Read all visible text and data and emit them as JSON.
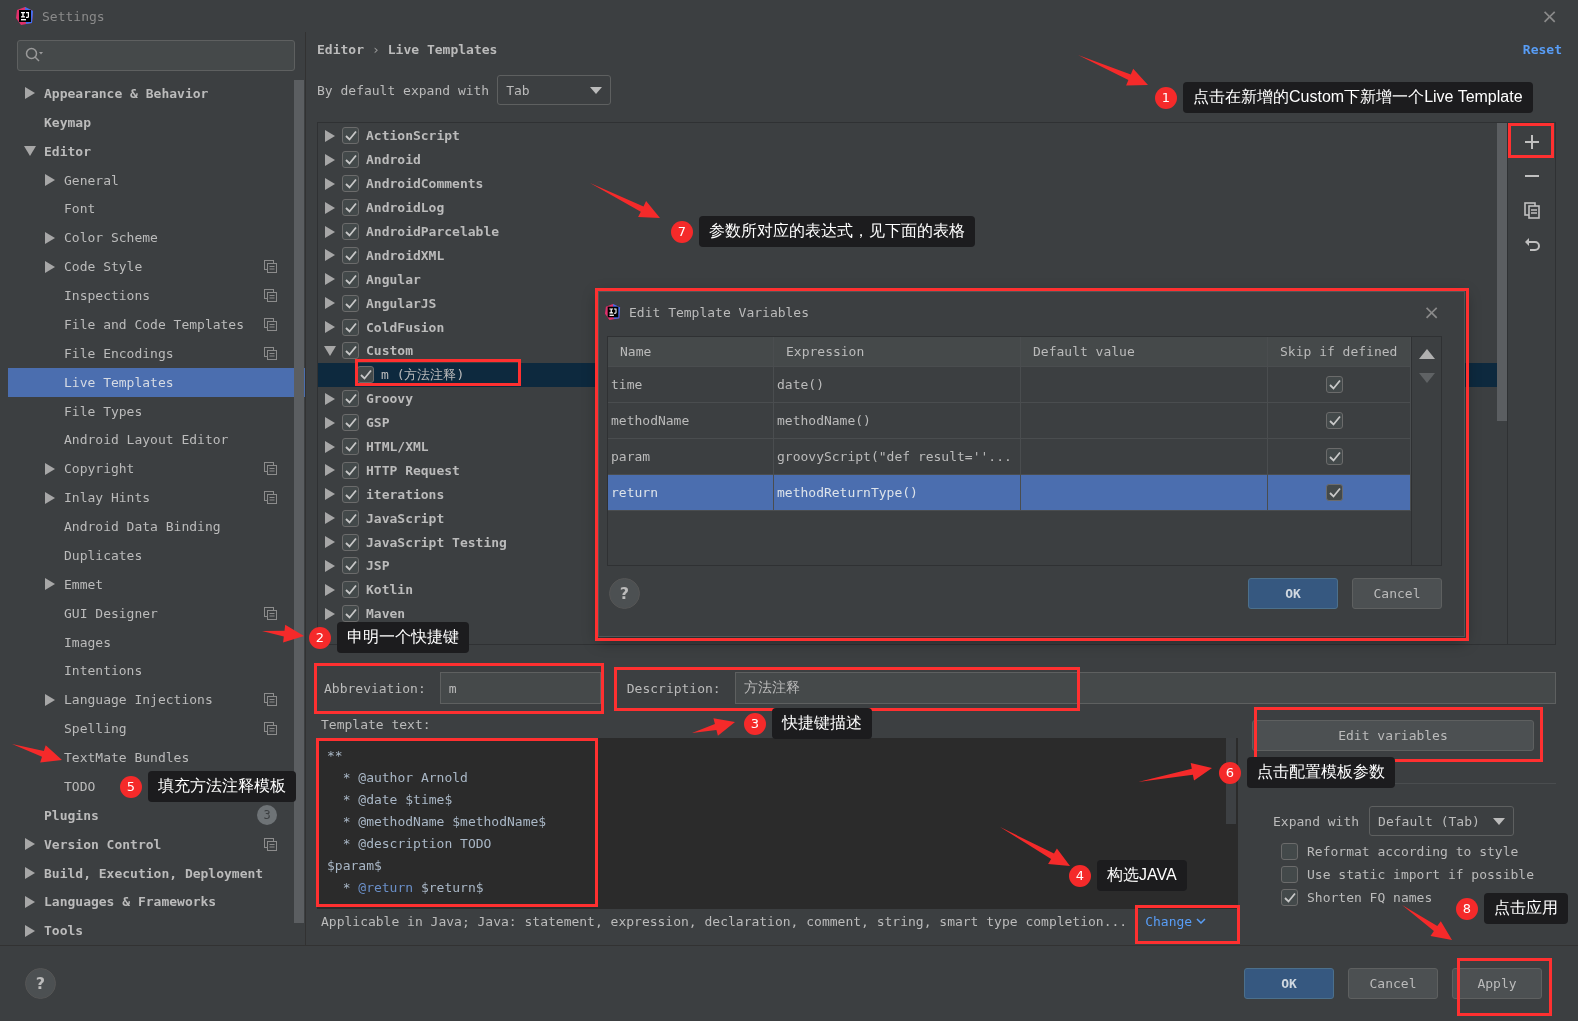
{
  "window": {
    "title": "Settings",
    "close": "×"
  },
  "sidebar": {
    "items": [
      {
        "label": "Appearance & Behavior",
        "kind": "folder",
        "expanded": false,
        "selected": false
      },
      {
        "label": "Keymap",
        "kind": "leaf",
        "selected": false
      },
      {
        "label": "Editor",
        "kind": "folder",
        "expanded": true,
        "selected": false,
        "children": [
          {
            "label": "General",
            "kind": "folder",
            "expanded": false,
            "selected": false
          },
          {
            "label": "Font",
            "kind": "leaf",
            "selected": false
          },
          {
            "label": "Color Scheme",
            "kind": "folder",
            "expanded": false,
            "selected": false
          },
          {
            "label": "Code Style",
            "kind": "folder",
            "expanded": false,
            "selected": false,
            "shared": true
          },
          {
            "label": "Inspections",
            "kind": "leaf",
            "selected": false,
            "shared": true
          },
          {
            "label": "File and Code Templates",
            "kind": "leaf",
            "selected": false,
            "shared": true
          },
          {
            "label": "File Encodings",
            "kind": "leaf",
            "selected": false,
            "shared": true
          },
          {
            "label": "Live Templates",
            "kind": "leaf",
            "selected": true
          },
          {
            "label": "File Types",
            "kind": "leaf",
            "selected": false
          },
          {
            "label": "Android Layout Editor",
            "kind": "leaf",
            "selected": false
          },
          {
            "label": "Copyright",
            "kind": "folder",
            "expanded": false,
            "selected": false,
            "shared": true
          },
          {
            "label": "Inlay Hints",
            "kind": "folder",
            "expanded": false,
            "selected": false,
            "shared": true
          },
          {
            "label": "Android Data Binding",
            "kind": "leaf",
            "selected": false
          },
          {
            "label": "Duplicates",
            "kind": "leaf",
            "selected": false
          },
          {
            "label": "Emmet",
            "kind": "folder",
            "expanded": false,
            "selected": false
          },
          {
            "label": "GUI Designer",
            "kind": "leaf",
            "selected": false,
            "shared": true
          },
          {
            "label": "Images",
            "kind": "leaf",
            "selected": false
          },
          {
            "label": "Intentions",
            "kind": "leaf",
            "selected": false
          },
          {
            "label": "Language Injections",
            "kind": "folder",
            "expanded": false,
            "selected": false,
            "shared": true
          },
          {
            "label": "Spelling",
            "kind": "leaf",
            "selected": false,
            "shared": true
          },
          {
            "label": "TextMate Bundles",
            "kind": "leaf",
            "selected": false
          },
          {
            "label": "TODO",
            "kind": "leaf",
            "selected": false
          }
        ]
      },
      {
        "label": "Plugins",
        "kind": "leaf",
        "selected": false,
        "badge": "3"
      },
      {
        "label": "Version Control",
        "kind": "folder",
        "expanded": false,
        "selected": false,
        "shared": true
      },
      {
        "label": "Build, Execution, Deployment",
        "kind": "folder",
        "expanded": false,
        "selected": false
      },
      {
        "label": "Languages & Frameworks",
        "kind": "folder",
        "expanded": false,
        "selected": false
      },
      {
        "label": "Tools",
        "kind": "folder",
        "expanded": false,
        "selected": false
      }
    ]
  },
  "breadcrumb": {
    "items": [
      "Editor",
      "Live Templates"
    ],
    "separator": "›"
  },
  "reset_link": "Reset",
  "expand_default": {
    "label": "By default expand with",
    "value": "Tab"
  },
  "template_groups": [
    {
      "name": "ActionScript",
      "checked": true,
      "expanded": false,
      "selected": false
    },
    {
      "name": "Android",
      "checked": true,
      "expanded": false,
      "selected": false
    },
    {
      "name": "AndroidComments",
      "checked": true,
      "expanded": false,
      "selected": false
    },
    {
      "name": "AndroidLog",
      "checked": true,
      "expanded": false,
      "selected": false
    },
    {
      "name": "AndroidParcelable",
      "checked": true,
      "expanded": false,
      "selected": false
    },
    {
      "name": "AndroidXML",
      "checked": true,
      "expanded": false,
      "selected": false
    },
    {
      "name": "Angular",
      "checked": true,
      "expanded": false,
      "selected": false
    },
    {
      "name": "AngularJS",
      "checked": true,
      "expanded": false,
      "selected": false
    },
    {
      "name": "ColdFusion",
      "checked": true,
      "expanded": false,
      "selected": false
    },
    {
      "name": "Custom",
      "checked": true,
      "expanded": true,
      "selected": false,
      "children": [
        {
          "name": "m (方法注释)",
          "checked": true,
          "selected": true
        }
      ]
    },
    {
      "name": "Groovy",
      "checked": true,
      "expanded": false,
      "selected": false
    },
    {
      "name": "GSP",
      "checked": true,
      "expanded": false,
      "selected": false
    },
    {
      "name": "HTML/XML",
      "checked": true,
      "expanded": false,
      "selected": false
    },
    {
      "name": "HTTP Request",
      "checked": true,
      "expanded": false,
      "selected": false
    },
    {
      "name": "iterations",
      "checked": true,
      "expanded": false,
      "selected": false
    },
    {
      "name": "JavaScript",
      "checked": true,
      "expanded": false,
      "selected": false
    },
    {
      "name": "JavaScript Testing",
      "checked": true,
      "expanded": false,
      "selected": false
    },
    {
      "name": "JSP",
      "checked": true,
      "expanded": false,
      "selected": false
    },
    {
      "name": "Kotlin",
      "checked": true,
      "expanded": false,
      "selected": false
    },
    {
      "name": "Maven",
      "checked": true,
      "expanded": false,
      "selected": false
    }
  ],
  "toolbar": [
    {
      "kind": "add"
    },
    {
      "kind": "remove"
    },
    {
      "kind": "copy"
    },
    {
      "kind": "revert"
    }
  ],
  "abbreviation": {
    "label": "Abbreviation:",
    "value": "m"
  },
  "description": {
    "label": "Description:",
    "value": "方法注释"
  },
  "template_text": {
    "label": "Template text:",
    "lines": [
      {
        "parts": [
          {
            "text": "**",
            "kind": "plain"
          }
        ]
      },
      {
        "parts": [
          {
            "text": "  * @author Arnold",
            "kind": "plain"
          }
        ]
      },
      {
        "parts": [
          {
            "text": "  * @date $time$",
            "kind": "plain"
          }
        ]
      },
      {
        "parts": [
          {
            "text": "  * @methodName $methodName$",
            "kind": "plain"
          }
        ]
      },
      {
        "parts": [
          {
            "text": "  * @description TODO",
            "kind": "plain"
          }
        ]
      },
      {
        "parts": [
          {
            "text": "$param$",
            "kind": "plain"
          }
        ]
      },
      {
        "parts": [
          {
            "text": "  * ",
            "kind": "plain"
          },
          {
            "text": "@return",
            "kind": "keyword"
          },
          {
            "text": " $return$",
            "kind": "plain"
          }
        ]
      }
    ]
  },
  "edit_variables_button": "Edit variables",
  "options": {
    "expand_with": {
      "label": "Expand with",
      "value": "Default (Tab)"
    },
    "checkboxes": [
      {
        "label": "Reformat according to style",
        "checked": false
      },
      {
        "label": "Use static import if possible",
        "checked": false
      },
      {
        "label": "Shorten FQ names",
        "checked": true
      }
    ]
  },
  "applicable": {
    "text": "Applicable in Java; Java: statement, expression, declaration, comment, string, smart type completion...",
    "link": "Change"
  },
  "help": "?",
  "footer_buttons": [
    {
      "label": "OK",
      "kind": "primary"
    },
    {
      "label": "Cancel",
      "kind": "default"
    },
    {
      "label": "Apply",
      "kind": "default"
    }
  ],
  "dialog": {
    "title": "Edit Template Variables",
    "close": "×",
    "columns": [
      "Name",
      "Expression",
      "Default value",
      "Skip if defined"
    ],
    "rows": [
      {
        "name": "time",
        "expression": "date()",
        "skip_if_defined": true,
        "selected": false
      },
      {
        "name": "methodName",
        "expression": "methodName()",
        "skip_if_defined": true,
        "selected": false
      },
      {
        "name": "param",
        "expression": "groovyScript(\"def result=''...",
        "skip_if_defined": true,
        "selected": false
      },
      {
        "name": "return",
        "expression": "methodReturnType()",
        "skip_if_defined": true,
        "selected": true
      }
    ],
    "help": "?",
    "buttons": [
      {
        "label": "OK",
        "kind": "primary"
      },
      {
        "label": "Cancel",
        "kind": "default"
      }
    ]
  },
  "annotations": [
    {
      "number": "1",
      "text": "点击在新增的Custom下新增一个Live Template"
    },
    {
      "number": "2",
      "text": "申明一个快捷键"
    },
    {
      "number": "3",
      "text": "快捷键描述"
    },
    {
      "number": "4",
      "text": "构选JAVA"
    },
    {
      "number": "5",
      "text": "填充方法注释模板"
    },
    {
      "number": "6",
      "text": "点击配置模板参数"
    },
    {
      "number": "7",
      "text": "参数所对应的表达式，见下面的表格"
    },
    {
      "number": "8",
      "text": "点击应用"
    }
  ]
}
